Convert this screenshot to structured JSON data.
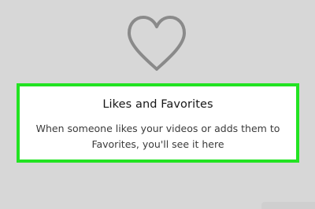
{
  "empty_state": {
    "icon": "heart-outline-icon",
    "title": "Likes and Favorites",
    "message": "When someone likes your videos or adds them to Favorites, you'll see it here"
  },
  "colors": {
    "background": "#d7d7d7",
    "card_background": "#ffffff",
    "highlight_border": "#22e322",
    "icon_stroke": "#8a8a8a",
    "title_text": "#161616",
    "message_text": "#3b3b3b"
  }
}
